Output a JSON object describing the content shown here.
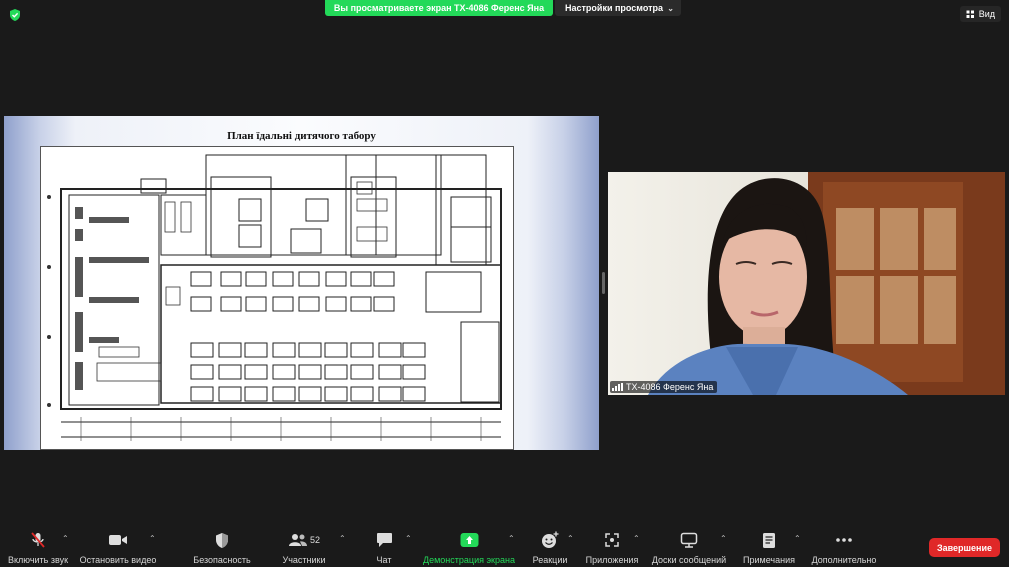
{
  "top": {
    "share_banner": "Вы просматриваете экран TX-4086 Ференс Яна",
    "view_options": "Настройки просмотра",
    "view_button": "Вид"
  },
  "shared_screen": {
    "title": "План їдальні дитячого табору"
  },
  "participant": {
    "name": "TX-4086 Ференс Яна"
  },
  "toolbar": {
    "mute": "Включить звук",
    "video": "Остановить видео",
    "security": "Безопасность",
    "participants": "Участники",
    "participants_count": "52",
    "chat": "Чат",
    "share": "Демонстрация экрана",
    "reactions": "Реакции",
    "apps": "Приложения",
    "whiteboards": "Доски сообщений",
    "notes": "Примечания",
    "more": "Дополнительно",
    "end": "Завершение"
  },
  "colors": {
    "green": "#23d959",
    "end": "#e02828",
    "bg": "#1a1a1a"
  }
}
